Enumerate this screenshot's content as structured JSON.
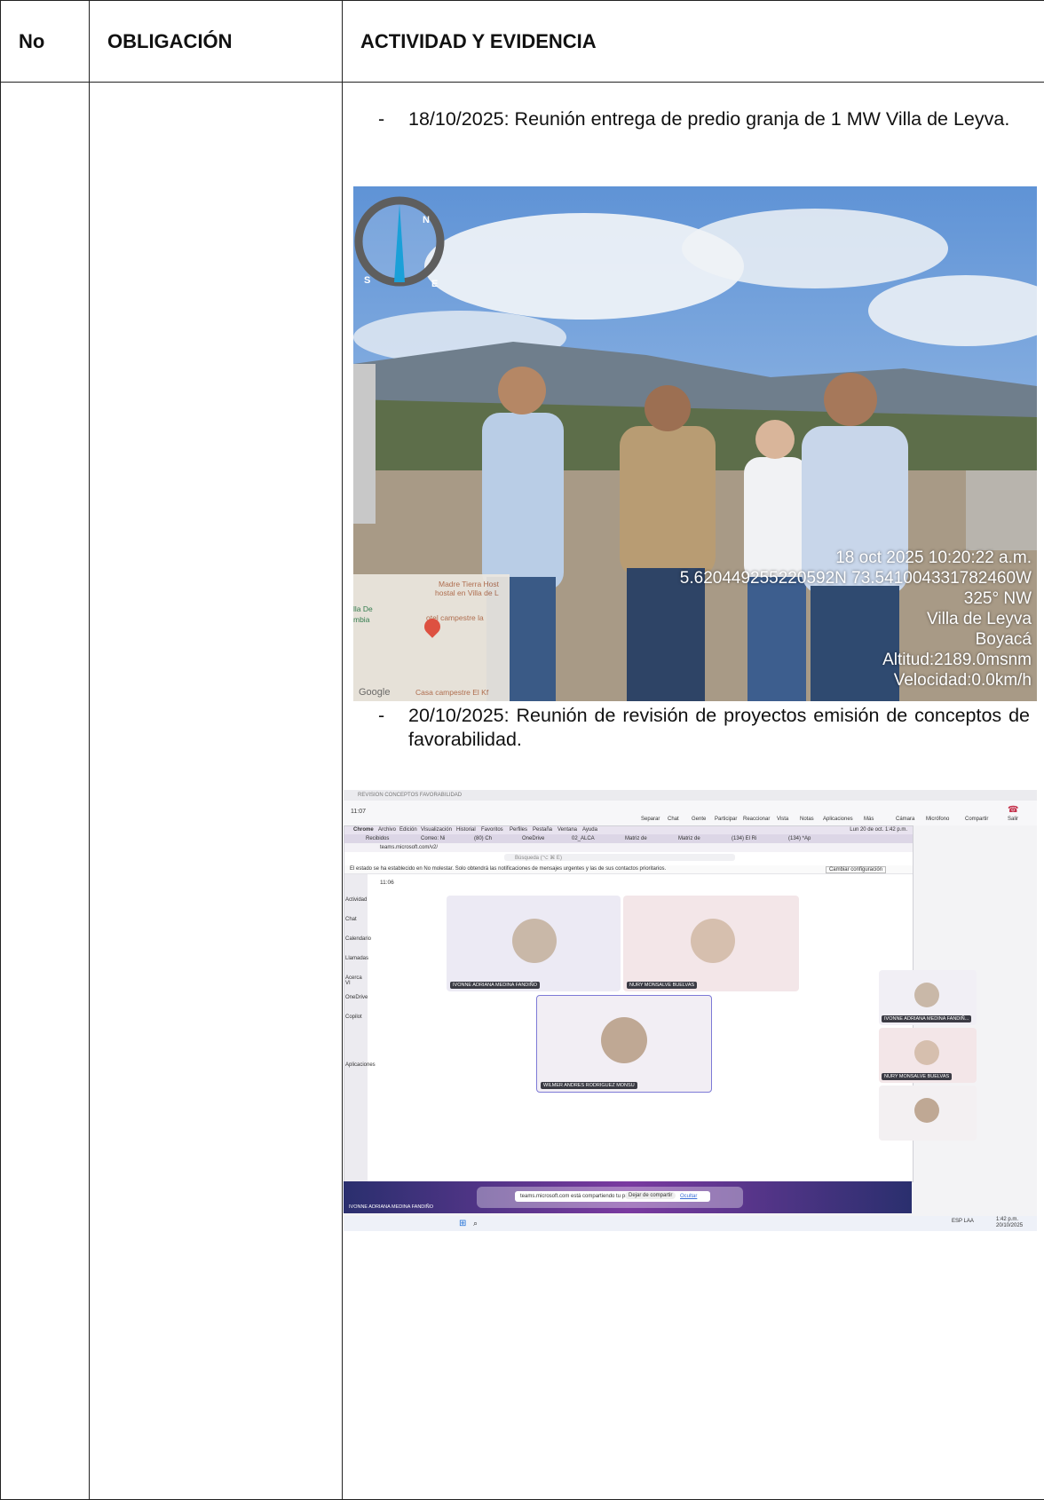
{
  "table": {
    "headers": {
      "no": "No",
      "obligacion": "OBLIGACIÓN",
      "actividad": "ACTIVIDAD Y EVIDENCIA"
    }
  },
  "entries": [
    {
      "dash": "-",
      "text": "18/10/2025: Reunión entrega de predio granja de 1 MW Villa de Leyva."
    },
    {
      "dash": "-",
      "text": "20/10/2025: Reunión de revisión de proyectos emisión de conceptos de favorabilidad."
    }
  ],
  "photo": {
    "compass": {
      "n": "N",
      "e": "E",
      "s": "S"
    },
    "stamp": {
      "datetime": "18 oct 2025 10:20:22 a.m.",
      "coords": "5.620449255220592N 73.541004331782460W",
      "heading": "325° NW",
      "place": "Villa de Leyva",
      "region": "Boyacá",
      "altitude": "Altitud:2189.0msnm",
      "speed": "Velocidad:0.0km/h"
    },
    "map": {
      "label1": "Madre Tierra Host",
      "label2": "hostal en Villa de L",
      "label3": "otel campestre la",
      "label4": "lla De",
      "label5": "mbia",
      "label6": "Casa campestre El Kf",
      "google": "Google"
    }
  },
  "teams": {
    "window_title": "REVISION CONCEPTOS FAVORABILIDAD",
    "time_outer": "11:07",
    "time_inner": "11:06",
    "toolbar": [
      "Separar",
      "Chat",
      "Gente",
      "Participar",
      "Reaccionar",
      "Vista",
      "Notas",
      "Aplicaciones",
      "Más",
      "Cámara",
      "Micrófono",
      "Compartir",
      "Salir"
    ],
    "mac_menu": [
      "Chrome",
      "Archivo",
      "Edición",
      "Visualización",
      "Historial",
      "Favoritos",
      "Perfiles",
      "Pestaña",
      "Ventana",
      "Ayuda"
    ],
    "mac_clock": "Lun 20 de oct. 1:42 p.m.",
    "tabs": [
      "Recibidos",
      "Correo: Ni",
      "(80) Ch",
      "OneDrive",
      "02_ALCA",
      "Matriz de",
      "Matriz de",
      "(134) El Ri",
      "(134) *Ap"
    ],
    "url": "teams.microsoft.com/v2/",
    "search": "Búsqueda (⌥ ⌘ E)",
    "notice": "El estado se ha establecido en No molestar. Solo obtendrá las notificaciones de mensajes urgentes y las de sus contactos prioritarios.",
    "notice_btn": "Cambiar configuración",
    "sidebar": [
      "Actividad",
      "Chat",
      "Calendario",
      "Llamadas",
      "Acerca VI",
      "OneDrive",
      "Copilot",
      "Aplicaciones"
    ],
    "participants": [
      "IVONNE ADRIANA MEDINA FANDIÑO",
      "NURY MONSALVE BUELVAS",
      "WILMER ANDRES RODRIGUEZ MONSU"
    ],
    "side_participants": [
      "IVONNE ADRIANA MEDINA FANDIÑ...",
      "NURY MONSALVE BUELVAS"
    ],
    "share_msg": "teams.microsoft.com está compartiendo tu pantalla.",
    "share_stop": "Dejar de compartir",
    "share_hide": "Ocultar",
    "bottom_name": "IVONNE ADRIANA MEDINA FANDIÑO",
    "taskbar_lang": "ESP LAA",
    "taskbar_time": "1:42 p.m.",
    "taskbar_date": "20/10/2025"
  }
}
